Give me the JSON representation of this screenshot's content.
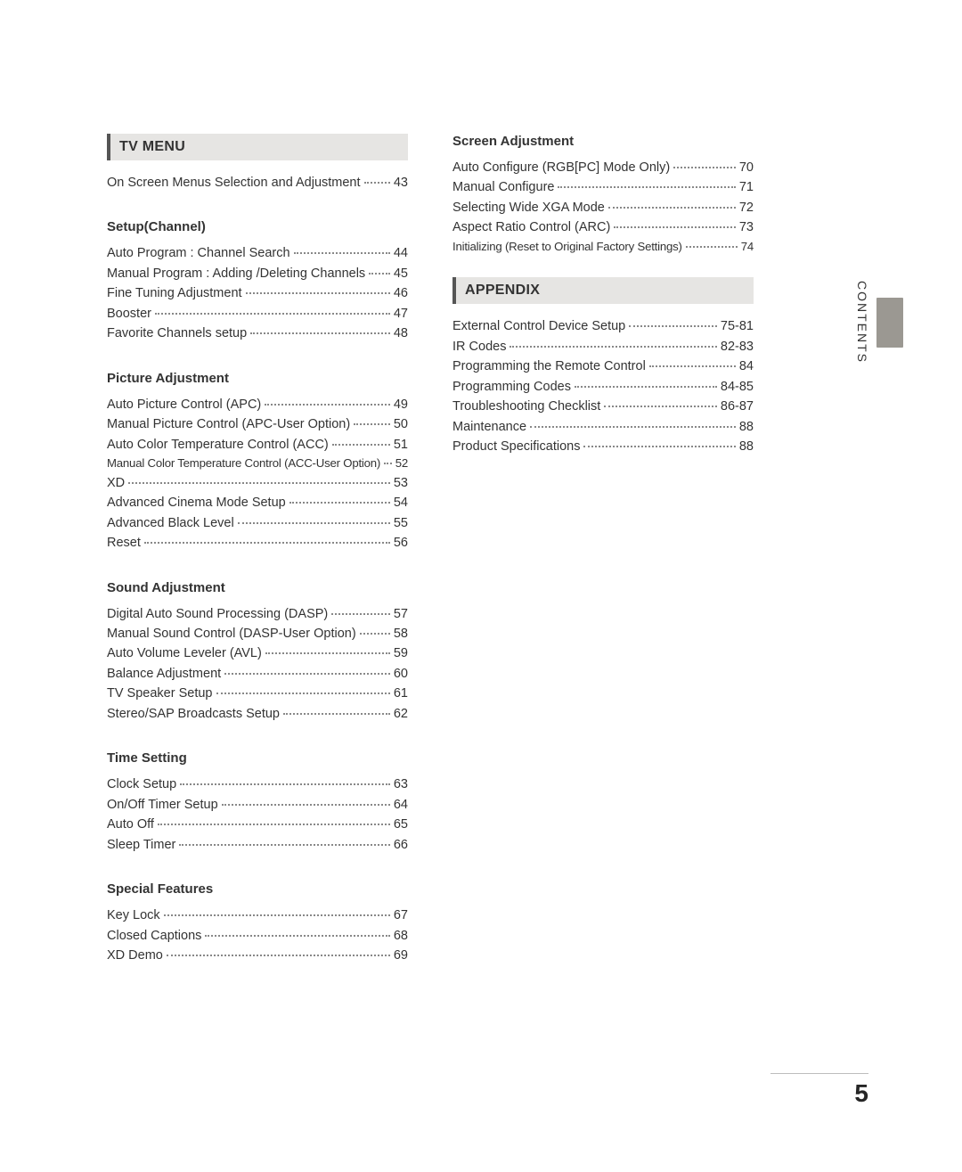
{
  "pageNumber": "5",
  "sideLabel": "CONTENTS",
  "left": {
    "header": "TV MENU",
    "introRow": {
      "label": "On Screen Menus Selection and Adjustment",
      "page": "43"
    },
    "groups": [
      {
        "title": "Setup(Channel)",
        "rows": [
          {
            "label": "Auto Program : Channel Search",
            "page": "44"
          },
          {
            "label": "Manual Program : Adding /Deleting Channels",
            "page": "45"
          },
          {
            "label": "Fine Tuning Adjustment",
            "page": "46"
          },
          {
            "label": "Booster",
            "page": "47"
          },
          {
            "label": "Favorite Channels setup",
            "page": "48"
          }
        ]
      },
      {
        "title": "Picture Adjustment",
        "rows": [
          {
            "label": "Auto Picture Control (APC)",
            "page": "49"
          },
          {
            "label": "Manual Picture Control (APC-User Option)",
            "page": "50"
          },
          {
            "label": "Auto Color Temperature Control (ACC)",
            "page": "51"
          },
          {
            "label": "Manual Color Temperature Control (ACC-User Option)",
            "page": "52",
            "tight": true
          },
          {
            "label": "XD",
            "page": "53"
          },
          {
            "label": "Advanced Cinema Mode Setup",
            "page": "54"
          },
          {
            "label": "Advanced Black Level",
            "page": "55"
          },
          {
            "label": "Reset",
            "page": "56"
          }
        ]
      },
      {
        "title": "Sound Adjustment",
        "rows": [
          {
            "label": "Digital Auto Sound Processing (DASP)",
            "page": "57"
          },
          {
            "label": "Manual Sound Control (DASP-User Option)",
            "page": "58"
          },
          {
            "label": "Auto Volume Leveler (AVL)",
            "page": "59"
          },
          {
            "label": "Balance Adjustment",
            "page": "60"
          },
          {
            "label": "TV Speaker Setup",
            "page": "61"
          },
          {
            "label": "Stereo/SAP Broadcasts Setup",
            "page": "62"
          }
        ]
      },
      {
        "title": "Time Setting",
        "rows": [
          {
            "label": "Clock Setup",
            "page": "63"
          },
          {
            "label": "On/Off Timer Setup",
            "page": "64"
          },
          {
            "label": "Auto Off",
            "page": "65"
          },
          {
            "label": "Sleep Timer",
            "page": "66"
          }
        ]
      },
      {
        "title": "Special Features",
        "rows": [
          {
            "label": "Key Lock",
            "page": "67"
          },
          {
            "label": "Closed Captions",
            "page": "68"
          },
          {
            "label": "XD Demo",
            "page": "69"
          }
        ]
      }
    ]
  },
  "right": {
    "groups": [
      {
        "title": "Screen Adjustment",
        "rows": [
          {
            "label": "Auto Configure (RGB[PC] Mode Only)",
            "page": "70"
          },
          {
            "label": "Manual Configure",
            "page": "71"
          },
          {
            "label": "Selecting Wide XGA Mode",
            "page": "72"
          },
          {
            "label": "Aspect Ratio Control (ARC)",
            "page": "73"
          },
          {
            "label": "Initializing (Reset to Original Factory Settings)",
            "page": "74",
            "tight": true
          }
        ]
      }
    ],
    "header": "APPENDIX",
    "appendixRows": [
      {
        "label": "External Control Device Setup",
        "page": "75-81"
      },
      {
        "label": "IR Codes",
        "page": "82-83"
      },
      {
        "label": "Programming the Remote Control",
        "page": "84"
      },
      {
        "label": "Programming Codes",
        "page": "84-85"
      },
      {
        "label": "Troubleshooting Checklist",
        "page": "86-87"
      },
      {
        "label": "Maintenance",
        "page": "88"
      },
      {
        "label": "Product Specifications",
        "page": "88"
      }
    ]
  }
}
